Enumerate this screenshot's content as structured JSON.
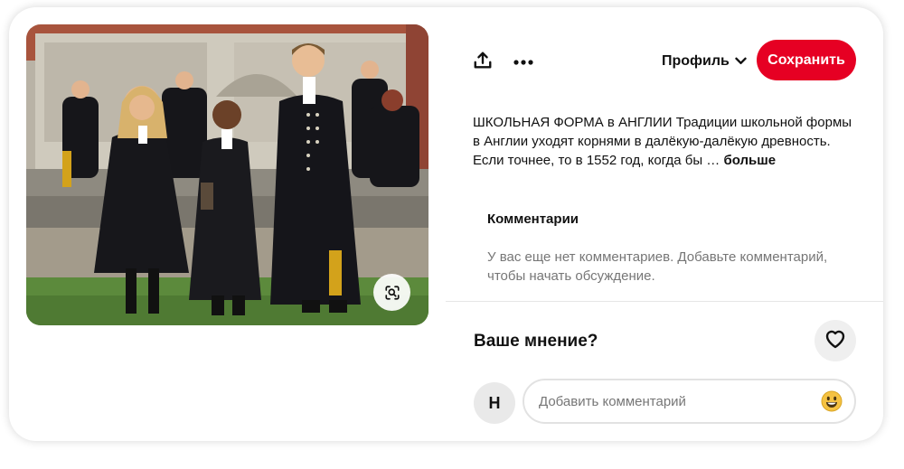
{
  "pin": {
    "image_alt": "Британские школьники в традиционной школьной форме",
    "visual_search_icon": "visual-search-icon"
  },
  "toolbar": {
    "share_icon": "share-icon",
    "more_icon": "more-icon",
    "profile_label": "Профиль",
    "save_label": "Сохранить",
    "accent_color": "#e60023"
  },
  "description": {
    "text": "ШКОЛЬНАЯ ФОРМА в АНГЛИИ Традиции школьной формы в Англии уходят корнями в далёкую-далёкую древность. Если точнее, то в 1552 год, когда бы",
    "ellipsis": "…",
    "more_label": "больше"
  },
  "comments": {
    "heading": "Комментарии",
    "empty_text": "У вас еще нет комментариев. Добавьте комментарий, чтобы начать обсуждение."
  },
  "opinion": {
    "title": "Ваше мнение?",
    "like_icon": "heart-icon"
  },
  "composer": {
    "avatar_initial": "Н",
    "placeholder": "Добавить комментарий",
    "emoji_icon": "smiley-emoji-icon"
  }
}
